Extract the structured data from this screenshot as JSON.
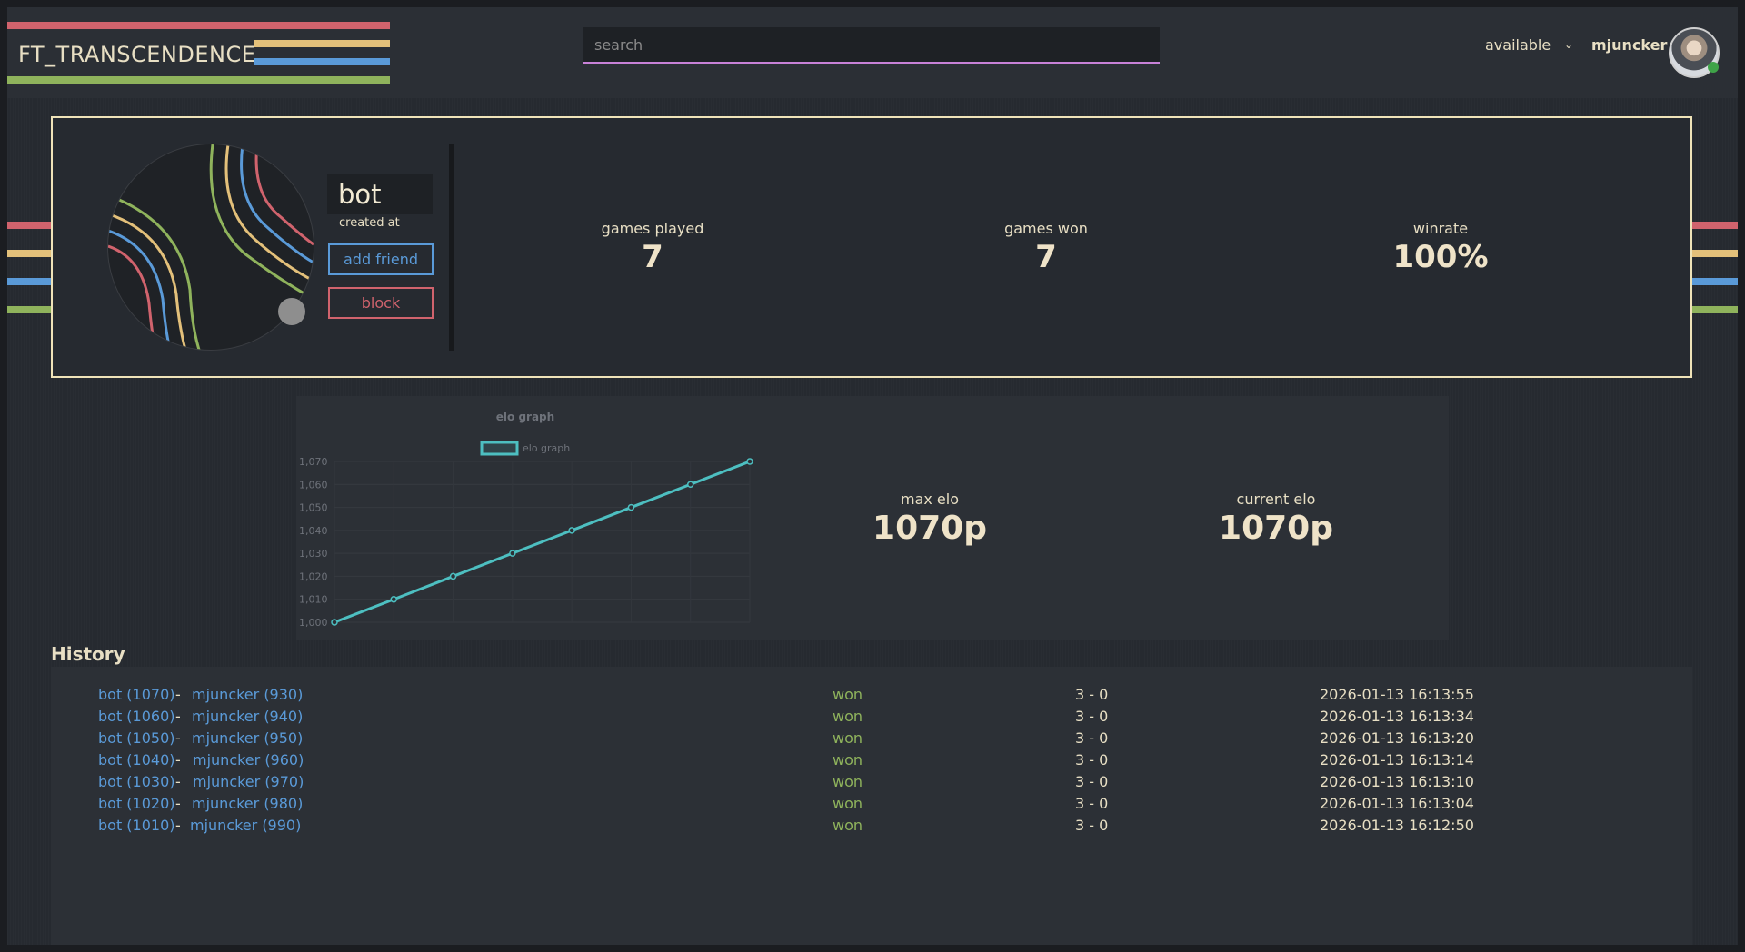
{
  "header": {
    "logo": "FT_TRANSCENDENCE",
    "search_placeholder": "search",
    "status": "available",
    "username": "mjuncker"
  },
  "colors": {
    "red": "#d0636d",
    "yellow": "#e3c07a",
    "blue": "#5a9ad8",
    "green": "#8fb35c",
    "accent": "#efe3b8"
  },
  "profile": {
    "name": "bot",
    "created_label": "created at",
    "add_friend": "add friend",
    "block": "block",
    "stats": [
      {
        "label": "games played",
        "value": "7"
      },
      {
        "label": "games won",
        "value": "7"
      },
      {
        "label": "winrate",
        "value": "100%"
      }
    ]
  },
  "elo": {
    "max_label": "max elo",
    "max_value": "1070p",
    "current_label": "current elo",
    "current_value": "1070p"
  },
  "chart_data": {
    "type": "line",
    "title": "elo graph",
    "legend": "elo graph",
    "legend_position": "top",
    "series": [
      {
        "name": "elo graph",
        "values": [
          1000,
          1010,
          1020,
          1030,
          1040,
          1050,
          1060,
          1070
        ]
      }
    ],
    "yticks": [
      "1,000",
      "1,010",
      "1,020",
      "1,030",
      "1,040",
      "1,050",
      "1,060",
      "1,070"
    ],
    "ylim": [
      1000,
      1070
    ],
    "grid": true,
    "color": "#4dbfc1"
  },
  "history": {
    "title": "History",
    "rows": [
      {
        "p1": "bot (1070)",
        "sep": "-",
        "p2": "mjuncker (930)",
        "result": "won",
        "score": "3 - 0",
        "date": "2026-01-13 16:13:55"
      },
      {
        "p1": "bot (1060)",
        "sep": "-",
        "p2": "mjuncker (940)",
        "result": "won",
        "score": "3 - 0",
        "date": "2026-01-13 16:13:34"
      },
      {
        "p1": "bot (1050)",
        "sep": "-",
        "p2": "mjuncker (950)",
        "result": "won",
        "score": "3 - 0",
        "date": "2026-01-13 16:13:20"
      },
      {
        "p1": "bot (1040)",
        "sep": "-",
        "p2": "mjuncker (960)",
        "result": "won",
        "score": "3 - 0",
        "date": "2026-01-13 16:13:14"
      },
      {
        "p1": "bot (1030)",
        "sep": "-",
        "p2": "mjuncker (970)",
        "result": "won",
        "score": "3 - 0",
        "date": "2026-01-13 16:13:10"
      },
      {
        "p1": "bot (1020)",
        "sep": "-",
        "p2": "mjuncker (980)",
        "result": "won",
        "score": "3 - 0",
        "date": "2026-01-13 16:13:04"
      },
      {
        "p1": "bot (1010)",
        "sep": "-",
        "p2": "mjuncker (990)",
        "result": "won",
        "score": "3 - 0",
        "date": "2026-01-13 16:12:50"
      }
    ]
  }
}
